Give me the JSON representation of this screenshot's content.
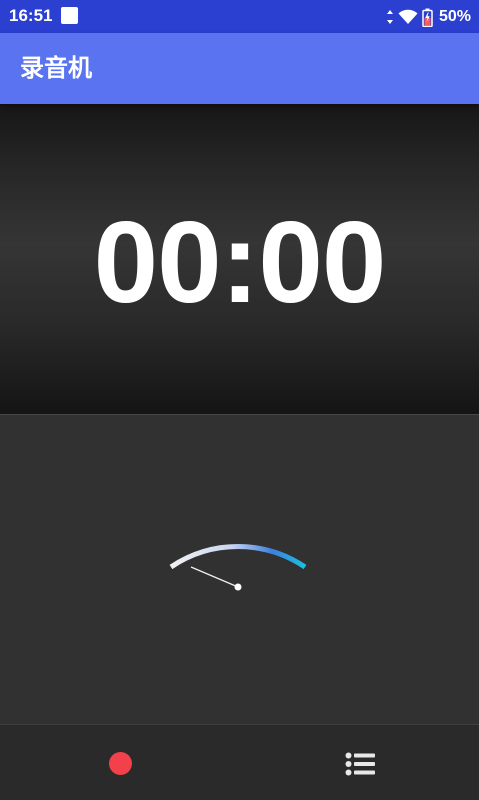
{
  "status_bar": {
    "time": "16:51",
    "battery_text": "50%",
    "icons": [
      "notification-square-icon",
      "data-arrows-icon",
      "wifi-icon",
      "battery-icon"
    ]
  },
  "app_bar": {
    "title": "录音机"
  },
  "timer": {
    "display": "00:00"
  },
  "level_meter": {
    "level": 0
  },
  "bottom_bar": {
    "icons": [
      "record-icon",
      "recordings-list-icon"
    ]
  },
  "colors": {
    "status_bar": "#2b3fd0",
    "app_bar": "#5a73f0",
    "record": "#f2414b",
    "meter_accent": "#1fb8e6"
  }
}
